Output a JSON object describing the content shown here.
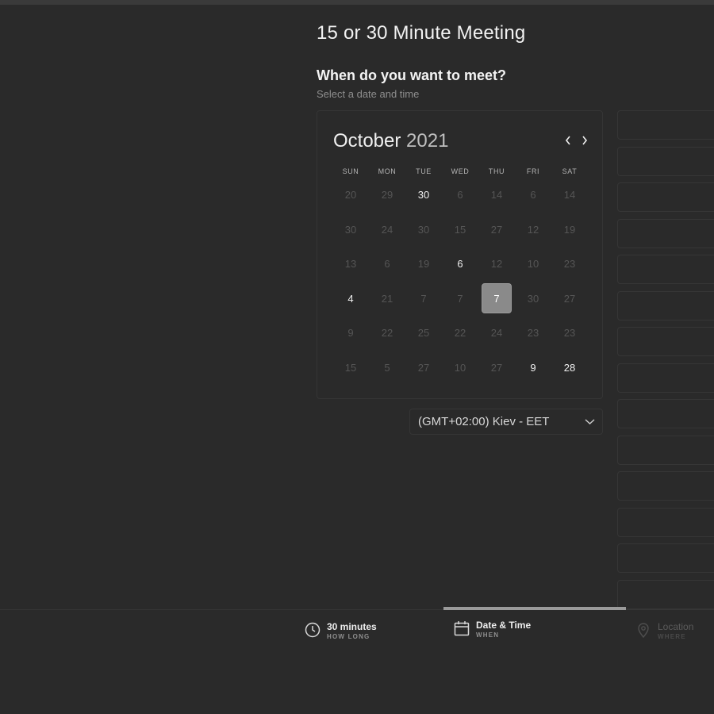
{
  "page": {
    "title": "15 or 30 Minute Meeting",
    "question": "When do you want to meet?",
    "subtitle": "Select a date and time"
  },
  "calendar": {
    "month": "October",
    "year": "2021",
    "weekdays": [
      "SUN",
      "MON",
      "TUE",
      "WED",
      "THU",
      "FRI",
      "SAT"
    ],
    "weeks": [
      [
        "20",
        "29",
        "30",
        "6",
        "14",
        "6",
        "14"
      ],
      [
        "30",
        "24",
        "30",
        "15",
        "27",
        "12",
        "19"
      ],
      [
        "13",
        "6",
        "19",
        "6",
        "12",
        "10",
        "23"
      ],
      [
        "4",
        "21",
        "7",
        "7",
        "7",
        "30",
        "27"
      ],
      [
        "9",
        "22",
        "25",
        "22",
        "24",
        "23",
        "23"
      ],
      [
        "15",
        "5",
        "27",
        "10",
        "27",
        "9",
        "28"
      ]
    ],
    "available": [
      [
        0,
        2
      ],
      [
        2,
        3
      ],
      [
        3,
        0
      ],
      [
        3,
        4
      ],
      [
        5,
        5
      ],
      [
        5,
        6
      ]
    ],
    "selected": [
      3,
      4
    ]
  },
  "timezone": {
    "label": "(GMT+02:00) Kiev - EET"
  },
  "time_slots": [
    "",
    "",
    "",
    "",
    "",
    "",
    "",
    "",
    "",
    "",
    "",
    "",
    "",
    ""
  ],
  "steps": [
    {
      "label": "30 minutes",
      "sub": "HOW LONG",
      "icon": "clock-icon",
      "state": "done"
    },
    {
      "label": "Date & Time",
      "sub": "WHEN",
      "icon": "calendar-icon",
      "state": "active"
    },
    {
      "label": "Location",
      "sub": "WHERE",
      "icon": "location-pin-icon",
      "state": "disabled"
    }
  ]
}
